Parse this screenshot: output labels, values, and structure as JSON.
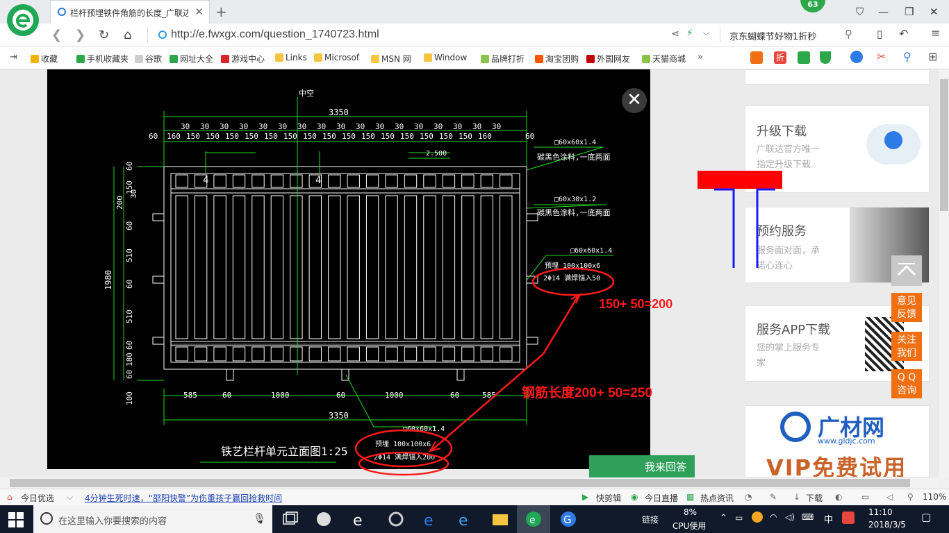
{
  "browser": {
    "tab_title": "栏杆预埋铁件角筋的长度_广联达",
    "badge": "63",
    "url": "http://e.fwxgx.com/question_1740723.html",
    "search_text": "京东蝴蝶节好物1折秒",
    "accent_color": "#1fa855"
  },
  "bookmarks": [
    {
      "label": "收藏",
      "icon": "star-icon",
      "color": "#f0b400"
    },
    {
      "label": "手机收藏夹",
      "icon": "phone-icon",
      "color": "#2ca84a"
    },
    {
      "label": "谷歌",
      "icon": "doc-icon",
      "color": "#cccccc"
    },
    {
      "label": "网址大全",
      "icon": "globe-icon",
      "color": "#2ca84a"
    },
    {
      "label": "游戏中心",
      "icon": "game-icon",
      "color": "#d9252a"
    },
    {
      "label": "Links",
      "icon": "folder-icon",
      "color": "#f5c542"
    },
    {
      "label": "Microsof",
      "icon": "folder-icon",
      "color": "#f5c542"
    },
    {
      "label": "MSN 网",
      "icon": "folder-icon",
      "color": "#f5c542"
    },
    {
      "label": "Window",
      "icon": "folder-icon",
      "color": "#f5c542"
    },
    {
      "label": "品牌打折",
      "icon": "leaf-icon",
      "color": "#8bc34a"
    },
    {
      "label": "淘宝团购",
      "icon": "taobao-icon",
      "color": "#ff5500"
    },
    {
      "label": "外国网友",
      "icon": "bookmark-icon",
      "color": "#c00000"
    },
    {
      "label": "天猫商城",
      "icon": "leaf-icon",
      "color": "#8bc34a"
    }
  ],
  "sidebar": {
    "upgrade_title": "升级下载",
    "upgrade_desc_1": "广联达官方唯一",
    "upgrade_desc_2": "指定升级下载",
    "booking_title": "预约服务",
    "booking_desc_1": "服务面对面，承",
    "booking_desc_2": "诺心连心",
    "app_title": "服务APP下载",
    "app_desc_1": "您的掌上服务专",
    "app_desc_2": "家",
    "ad_brand": "广材网",
    "ad_url": "www.gldjc.com",
    "ad_vip": "VIP免费试用"
  },
  "float_buttons": {
    "feedback": [
      "意见",
      "反馈"
    ],
    "follow": [
      "关注",
      "我们"
    ],
    "qq": [
      "Q Q",
      "咨询"
    ]
  },
  "modal": {
    "close_label": "✕",
    "answer_button": "我来回答"
  },
  "drawing": {
    "hollow": "中空",
    "overall_width": "3350",
    "spacing_row": [
      "30",
      "30",
      "30",
      "30",
      "30",
      "30",
      "30",
      "30",
      "30",
      "30",
      "30",
      "30",
      "30",
      "30",
      "30",
      "30",
      "30"
    ],
    "bar_row": [
      "60",
      "160",
      "150",
      "150",
      "150",
      "150",
      "150",
      "150",
      "150",
      "150",
      "150",
      "150",
      "150",
      "150",
      "150",
      "150",
      "150",
      "160",
      "60"
    ],
    "dim_2500": "2.500",
    "mark_4": "4",
    "note1_section": "□60x60x1.4",
    "note1_paint": "碳黑色涂料,一底两面",
    "note2_section": "□60x30x1.2",
    "note2_paint": "碳黑色涂料,一底两面",
    "note3_section": "□60x60x1.4",
    "note3_embed": "预埋 100x100x6",
    "note3_anchor": "2Φ14  满焊锚入50",
    "left_dims": [
      "60",
      "150",
      "30",
      "200",
      "60",
      "510",
      "60",
      "510",
      "60",
      "180",
      "60",
      "100"
    ],
    "height_total": "1980",
    "bottom_dims": [
      "585",
      "60",
      "1000",
      "60",
      "1000",
      "60",
      "585"
    ],
    "bottom_total": "3350",
    "note4_section": "□60x60x1.4",
    "note4_embed": "预埋 100x100x6",
    "note4_anchor": "2Φ14  满焊锚入200",
    "drawing_title": "铁艺栏杆单元立面图1:25"
  },
  "annotations": {
    "calc1": "150+ 50=200",
    "calc2": "钢筋长度200+ 50=250",
    "red_color": "#ff1a1a"
  },
  "statusbar": {
    "today_pick": "今日优选",
    "news": "4分钟生死时速，“邵阳快警”为伤重孩子赢回抢救时间",
    "kuaijian": "快剪辑",
    "live": "今日直播",
    "hot": "热点资讯",
    "download": "下载",
    "zoom": "110%"
  },
  "taskbar": {
    "search_placeholder": "在这里输入你要搜索的内容",
    "link_label": "链接",
    "cpu_percent": "8%",
    "cpu_label": "CPU使用",
    "ime": "中",
    "time": "11:10",
    "date": "2018/3/5"
  }
}
